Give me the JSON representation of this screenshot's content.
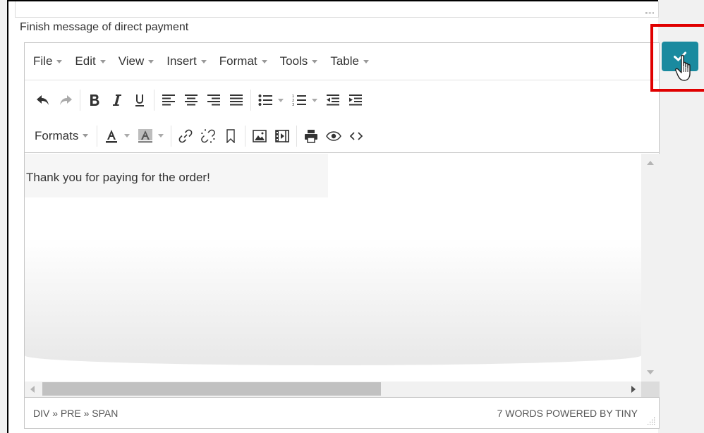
{
  "field": {
    "label": "Finish message of direct payment"
  },
  "menubar": {
    "items": [
      {
        "label": "File"
      },
      {
        "label": "Edit"
      },
      {
        "label": "View"
      },
      {
        "label": "Insert"
      },
      {
        "label": "Format"
      },
      {
        "label": "Tools"
      },
      {
        "label": "Table"
      }
    ]
  },
  "toolbar": {
    "formats_label": "Formats"
  },
  "content": {
    "text": "Thank you for paying for the order!"
  },
  "status": {
    "path": "DIV » PRE » SPAN",
    "right": "7 WORDS POWERED BY TINY"
  },
  "colors": {
    "accent": "#1a8a9f",
    "highlight": "#e00000"
  }
}
